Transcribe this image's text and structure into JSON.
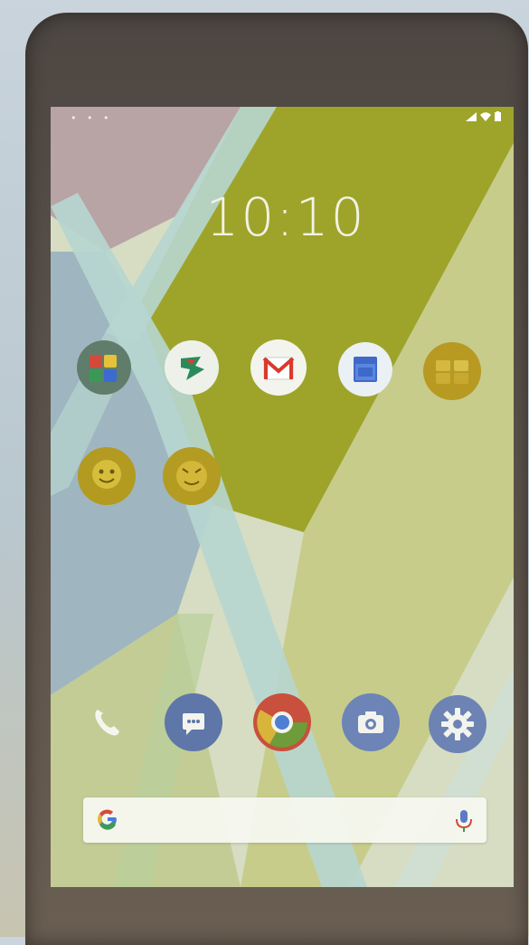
{
  "status_bar": {
    "left_indicators": "• • •",
    "signal_icon": "signal-icon",
    "wifi_icon": "wifi-icon",
    "battery_icon": "battery-icon"
  },
  "clock": {
    "time": "10:10",
    "date": ""
  },
  "home_grid": {
    "row1": [
      {
        "name": "folder-maps",
        "icon": "map-icon"
      },
      {
        "name": "app-play-store",
        "icon": "store-icon"
      },
      {
        "name": "app-gmail",
        "icon": "gmail-icon"
      },
      {
        "name": "app-calendar",
        "icon": "calendar-icon"
      },
      {
        "name": "app-yellow-folder",
        "icon": "folder-icon"
      }
    ],
    "row2": [
      {
        "name": "app-yellow-1",
        "icon": "smiley-icon"
      },
      {
        "name": "app-yellow-2",
        "icon": "smiley-icon"
      }
    ],
    "folder_label": ""
  },
  "dock": [
    {
      "name": "phone-app",
      "icon": "phone-icon"
    },
    {
      "name": "messages-app",
      "icon": "messages-icon"
    },
    {
      "name": "chrome-app",
      "icon": "browser-icon"
    },
    {
      "name": "camera-app",
      "icon": "camera-icon"
    },
    {
      "name": "settings-app",
      "icon": "gear-icon"
    }
  ],
  "search_bar": {
    "google_icon": "google-icon",
    "mic_icon": "mic-icon"
  },
  "colors": {
    "olive": "#9ea42a",
    "pale_teal": "#b7d6d0",
    "grey_blue": "#9fb6c0",
    "mauve": "#bfa9a8",
    "light_olive": "#c7cc8b"
  }
}
